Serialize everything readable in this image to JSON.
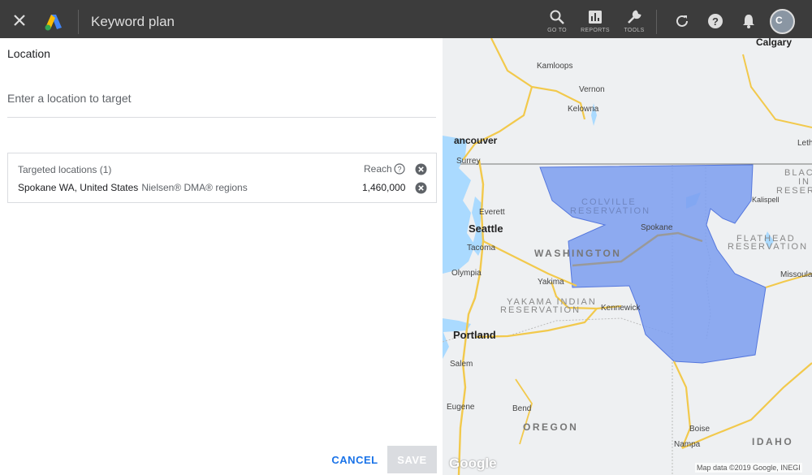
{
  "header": {
    "title": "Keyword plan",
    "tools": [
      {
        "label": "GO TO"
      },
      {
        "label": "REPORTS"
      },
      {
        "label": "TOOLS"
      }
    ],
    "avatar_text": "C"
  },
  "location_panel": {
    "title": "Location",
    "input_placeholder": "Enter a location to target",
    "targeted": {
      "header": "Targeted locations (1)",
      "reach_label": "Reach",
      "rows": [
        {
          "name": "Spokane WA, United States",
          "type": "Nielsen® DMA® regions",
          "reach": "1,460,000"
        }
      ]
    },
    "cancel_label": "CANCEL",
    "save_label": "SAVE"
  },
  "map": {
    "cities": {
      "kamloops": "Kamloops",
      "vernon": "Vernon",
      "kelowna": "Kelowna",
      "vancouver": "ancouver",
      "surrey": "Surrey",
      "everett": "Everett",
      "seattle": "Seattle",
      "tacoma": "Tacoma",
      "olympia": "Olympia",
      "yakima": "Yakima",
      "kennewick": "Kennewick",
      "portland": "Portland",
      "salem": "Salem",
      "eugene": "Eugene",
      "bend": "Bend",
      "spokane": "Spokane",
      "kalispell": "Kalispell",
      "missoula": "Missoula",
      "boise": "Boise",
      "nampa": "Nampa",
      "calgary": "Calgary",
      "lethbridge": "Leth"
    },
    "regions": {
      "colville_1": "COLVILLE",
      "colville_2": "RESERVATION",
      "yakama_1": "YAKAMA INDIAN",
      "yakama_2": "RESERVATION",
      "flathead_1": "FLATHEAD",
      "flathead_2": "RESERVATION",
      "blackfeet_1": "BLAC",
      "blackfeet_2": "IN",
      "blackfeet_3": "RESER"
    },
    "states": {
      "washington": "WASHINGTON",
      "oregon": "OREGON",
      "idaho": "IDAHO"
    },
    "google_logo": "Google",
    "credit": "Map data ©2019 Google, INEGI"
  },
  "colors": {
    "topbar": "#3c3c3c",
    "accent": "#1a73e8",
    "dma_fill": "#7b9ef0",
    "water": "#aadaff"
  }
}
